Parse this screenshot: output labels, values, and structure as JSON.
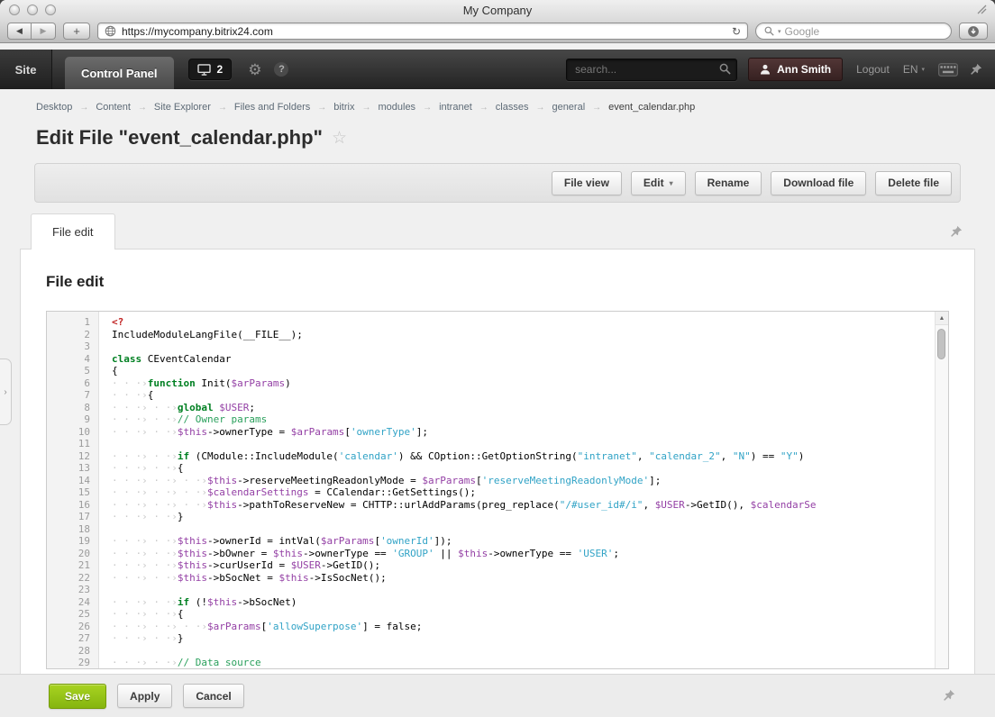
{
  "browser": {
    "window_title": "My Company",
    "url": "https://mycompany.bitrix24.com",
    "search_placeholder": "Google"
  },
  "header": {
    "site_label": "Site",
    "control_panel_label": "Control Panel",
    "notifications_count": "2",
    "search_placeholder": "search...",
    "user_name": "Ann Smith",
    "logout_label": "Logout",
    "lang_label": "EN"
  },
  "breadcrumb": {
    "items": [
      "Desktop",
      "Content",
      "Site Explorer",
      "Files and Folders",
      "bitrix",
      "modules",
      "intranet",
      "classes",
      "general",
      "event_calendar.php"
    ]
  },
  "page": {
    "title": "Edit File \"event_calendar.php\""
  },
  "toolbar": {
    "buttons": [
      "File view",
      "Edit",
      "Rename",
      "Download file",
      "Delete file"
    ]
  },
  "tabs": {
    "file_edit": "File edit"
  },
  "editor": {
    "heading": "File edit",
    "lines": [
      {
        "n": 1,
        "toks": [
          [
            "t",
            "<?"
          ]
        ]
      },
      {
        "n": 2,
        "toks": [
          [
            "p",
            "IncludeModuleLangFile(__FILE__);"
          ]
        ]
      },
      {
        "n": 3,
        "toks": []
      },
      {
        "n": 4,
        "toks": [
          [
            "k",
            "class"
          ],
          [
            "p",
            " CEventCalendar"
          ]
        ]
      },
      {
        "n": 5,
        "toks": [
          [
            "p",
            "{"
          ]
        ]
      },
      {
        "n": 6,
        "toks": [
          [
            "w",
            "· · ·›"
          ],
          [
            "k",
            "function"
          ],
          [
            "p",
            " Init("
          ],
          [
            "v",
            "$arParams"
          ],
          [
            "p",
            ")"
          ]
        ]
      },
      {
        "n": 7,
        "toks": [
          [
            "w",
            "· · ·›"
          ],
          [
            "p",
            "{"
          ]
        ]
      },
      {
        "n": 8,
        "toks": [
          [
            "w",
            "· · ·› · ·›"
          ],
          [
            "k",
            "global"
          ],
          [
            "p",
            " "
          ],
          [
            "v",
            "$USER"
          ],
          [
            "p",
            ";"
          ]
        ]
      },
      {
        "n": 9,
        "toks": [
          [
            "w",
            "· · ·› · ·›"
          ],
          [
            "c",
            "// Owner params"
          ]
        ]
      },
      {
        "n": 10,
        "toks": [
          [
            "w",
            "· · ·› · ·›"
          ],
          [
            "v",
            "$this"
          ],
          [
            "p",
            "->ownerType = "
          ],
          [
            "v",
            "$arParams"
          ],
          [
            "p",
            "["
          ],
          [
            "s",
            "'ownerType'"
          ],
          [
            "p",
            "];"
          ]
        ]
      },
      {
        "n": 11,
        "toks": []
      },
      {
        "n": 12,
        "toks": [
          [
            "w",
            "· · ·› · ·›"
          ],
          [
            "k",
            "if"
          ],
          [
            "p",
            " (CModule::IncludeModule("
          ],
          [
            "s",
            "'calendar'"
          ],
          [
            "p",
            ") && COption::GetOptionString("
          ],
          [
            "s",
            "\"intranet\""
          ],
          [
            "p",
            ", "
          ],
          [
            "s",
            "\"calendar_2\""
          ],
          [
            "p",
            ", "
          ],
          [
            "s",
            "\"N\""
          ],
          [
            "p",
            ") == "
          ],
          [
            "s",
            "\"Y\""
          ],
          [
            "p",
            ")"
          ]
        ]
      },
      {
        "n": 13,
        "toks": [
          [
            "w",
            "· · ·› · ·›"
          ],
          [
            "p",
            "{"
          ]
        ]
      },
      {
        "n": 14,
        "toks": [
          [
            "w",
            "· · ·› · ·› · ·›"
          ],
          [
            "v",
            "$this"
          ],
          [
            "p",
            "->reserveMeetingReadonlyMode = "
          ],
          [
            "v",
            "$arParams"
          ],
          [
            "p",
            "["
          ],
          [
            "s",
            "'reserveMeetingReadonlyMode'"
          ],
          [
            "p",
            "];"
          ]
        ]
      },
      {
        "n": 15,
        "toks": [
          [
            "w",
            "· · ·› · ·› · ·›"
          ],
          [
            "v",
            "$calendarSettings"
          ],
          [
            "p",
            " = CCalendar::GetSettings();"
          ]
        ]
      },
      {
        "n": 16,
        "toks": [
          [
            "w",
            "· · ·› · ·› · ·›"
          ],
          [
            "v",
            "$this"
          ],
          [
            "p",
            "->pathToReserveNew = CHTTP::urlAddParams(preg_replace("
          ],
          [
            "s",
            "\"/#user_id#/i\""
          ],
          [
            "p",
            ", "
          ],
          [
            "v",
            "$USER"
          ],
          [
            "p",
            "->GetID(), "
          ],
          [
            "v",
            "$calendarSe"
          ]
        ]
      },
      {
        "n": 17,
        "toks": [
          [
            "w",
            "· · ·› · ·›"
          ],
          [
            "p",
            "}"
          ]
        ]
      },
      {
        "n": 18,
        "toks": []
      },
      {
        "n": 19,
        "toks": [
          [
            "w",
            "· · ·› · ·›"
          ],
          [
            "v",
            "$this"
          ],
          [
            "p",
            "->ownerId = intVal("
          ],
          [
            "v",
            "$arParams"
          ],
          [
            "p",
            "["
          ],
          [
            "s",
            "'ownerId'"
          ],
          [
            "p",
            "]);"
          ]
        ]
      },
      {
        "n": 20,
        "toks": [
          [
            "w",
            "· · ·› · ·›"
          ],
          [
            "v",
            "$this"
          ],
          [
            "p",
            "->bOwner = "
          ],
          [
            "v",
            "$this"
          ],
          [
            "p",
            "->ownerType == "
          ],
          [
            "s",
            "'GROUP'"
          ],
          [
            "p",
            " || "
          ],
          [
            "v",
            "$this"
          ],
          [
            "p",
            "->ownerType == "
          ],
          [
            "s",
            "'USER'"
          ],
          [
            "p",
            ";"
          ]
        ]
      },
      {
        "n": 21,
        "toks": [
          [
            "w",
            "· · ·› · ·›"
          ],
          [
            "v",
            "$this"
          ],
          [
            "p",
            "->curUserId = "
          ],
          [
            "v",
            "$USER"
          ],
          [
            "p",
            "->GetID();"
          ]
        ]
      },
      {
        "n": 22,
        "toks": [
          [
            "w",
            "· · ·› · ·›"
          ],
          [
            "v",
            "$this"
          ],
          [
            "p",
            "->bSocNet = "
          ],
          [
            "v",
            "$this"
          ],
          [
            "p",
            "->IsSocNet();"
          ]
        ]
      },
      {
        "n": 23,
        "toks": []
      },
      {
        "n": 24,
        "toks": [
          [
            "w",
            "· · ·› · ·›"
          ],
          [
            "k",
            "if"
          ],
          [
            "p",
            " (!"
          ],
          [
            "v",
            "$this"
          ],
          [
            "p",
            "->bSocNet)"
          ]
        ]
      },
      {
        "n": 25,
        "toks": [
          [
            "w",
            "· · ·› · ·›"
          ],
          [
            "p",
            "{"
          ]
        ]
      },
      {
        "n": 26,
        "toks": [
          [
            "w",
            "· · ·› · ·› · ·›"
          ],
          [
            "v",
            "$arParams"
          ],
          [
            "p",
            "["
          ],
          [
            "s",
            "'allowSuperpose'"
          ],
          [
            "p",
            "] = false;"
          ]
        ]
      },
      {
        "n": 27,
        "toks": [
          [
            "w",
            "· · ·› · ·›"
          ],
          [
            "p",
            "}"
          ]
        ]
      },
      {
        "n": 28,
        "toks": []
      },
      {
        "n": 29,
        "toks": [
          [
            "w",
            "· · ·› · ·›"
          ],
          [
            "c",
            "// Data source"
          ]
        ]
      }
    ]
  },
  "footer": {
    "save": "Save",
    "apply": "Apply",
    "cancel": "Cancel"
  },
  "colors": {
    "accent_save_green": "#85b50f",
    "header_user_bg": "#362121",
    "code_keyword": "#008022",
    "code_variable": "#9440a5",
    "code_string": "#31a3c6",
    "code_comment": "#2aa05c",
    "code_tag": "#c02222",
    "code_whitespace": "#c9c9c9",
    "code_plain": "#000000"
  }
}
